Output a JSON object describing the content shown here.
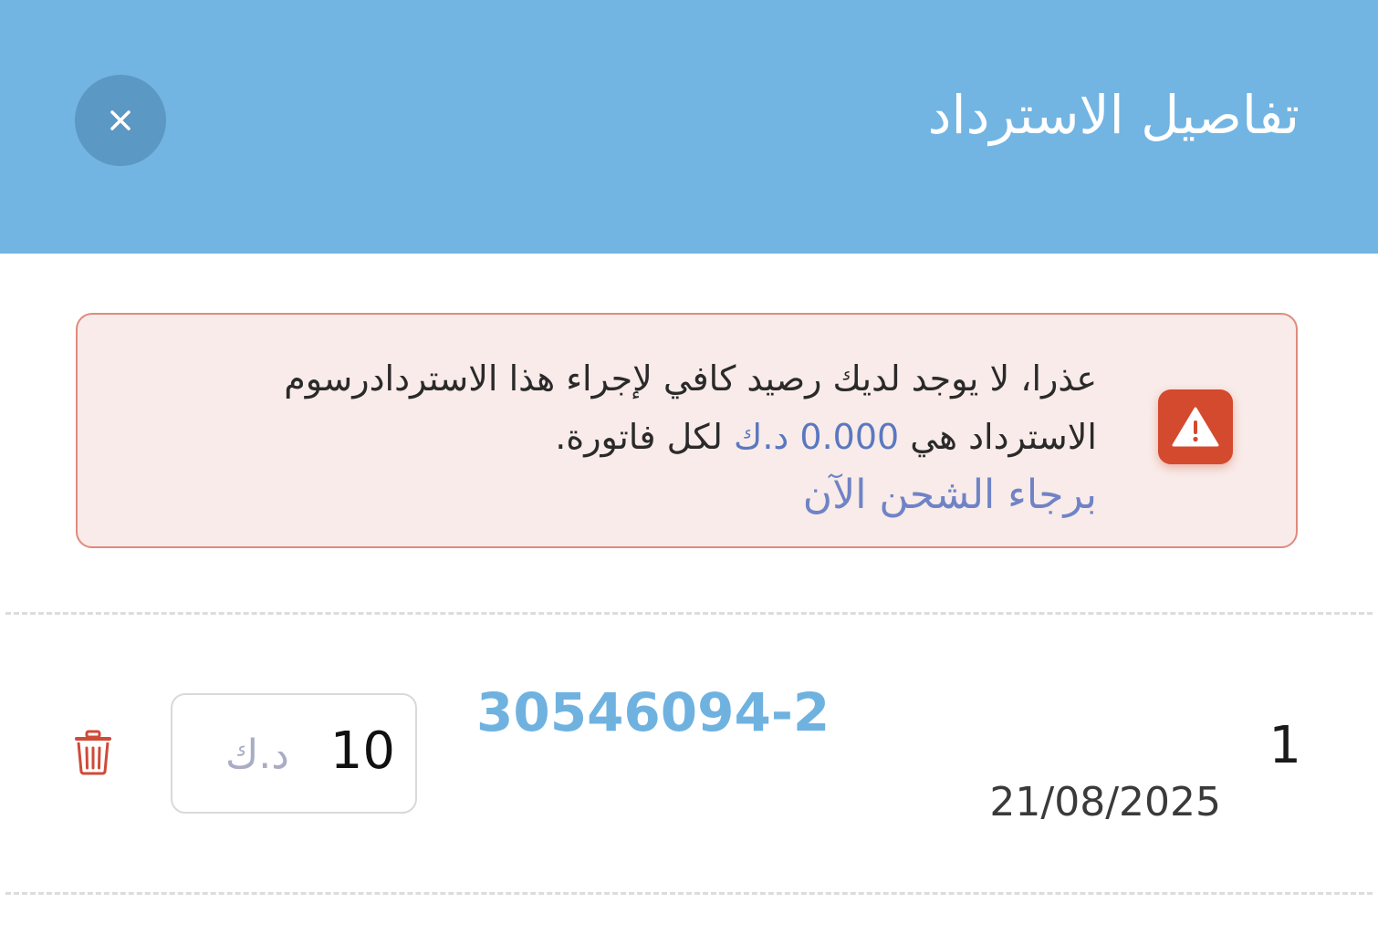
{
  "header": {
    "title": "تفاصيل الاسترداد",
    "close_label": "×"
  },
  "alert": {
    "line1": "عذرا، لا يوجد لديك رصيد كافي لإجراء هذا الاستردادرسوم",
    "line2_prefix": "الاسترداد هي ",
    "fee_amount": "0.000 د.ك",
    "line2_suffix": " لكل فاتورة.",
    "recharge_link": "برجاء الشحن الآن",
    "icon": "warning-icon"
  },
  "refund_items": [
    {
      "index": "1",
      "date": "21/08/2025",
      "invoice_number": "30546094-2",
      "amount": "10",
      "currency": "د.ك"
    }
  ],
  "colors": {
    "header_bg": "#72b4e2",
    "alert_bg": "#f8ebe9",
    "alert_border": "#e08a7c",
    "warning_badge": "#d34a2e",
    "link": "#6fb2e0",
    "fee_highlight": "#5a78c0",
    "delete": "#d04a38"
  }
}
